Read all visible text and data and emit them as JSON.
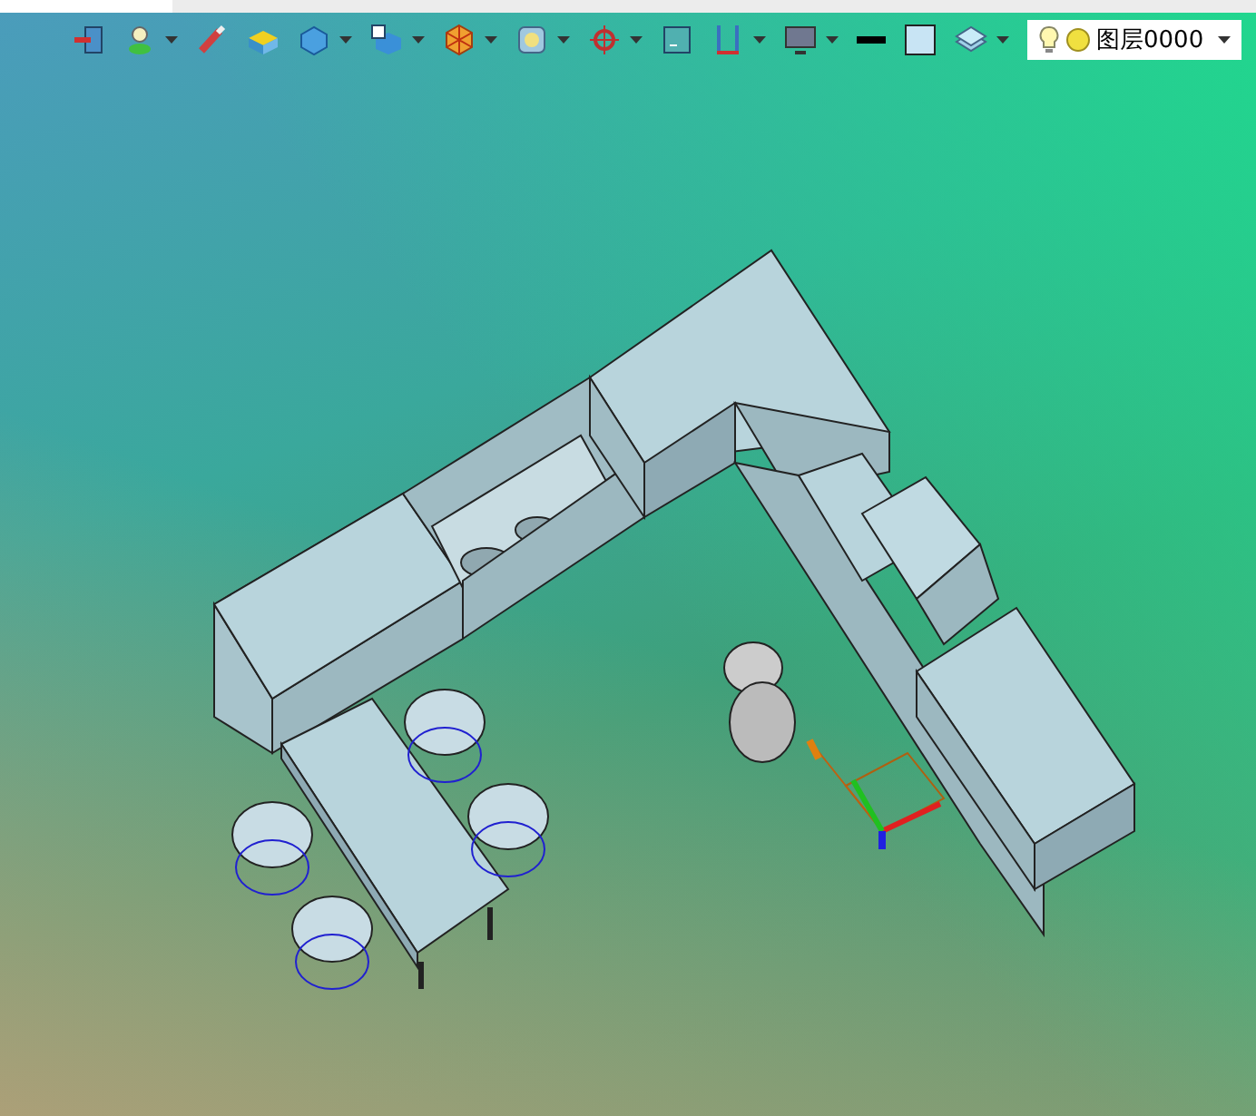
{
  "toolbar": {
    "buttons": [
      {
        "kind": "exit",
        "dropdown": false
      },
      {
        "kind": "light",
        "dropdown": true
      },
      {
        "kind": "brush",
        "dropdown": false
      },
      {
        "kind": "box",
        "dropdown": false
      },
      {
        "kind": "cube",
        "dropdown": true
      },
      {
        "kind": "viewcube",
        "dropdown": true
      },
      {
        "kind": "ball",
        "dropdown": true
      },
      {
        "kind": "zoom",
        "dropdown": true
      },
      {
        "kind": "orbit",
        "dropdown": true
      },
      {
        "kind": "frame",
        "dropdown": false
      },
      {
        "kind": "section",
        "dropdown": true
      },
      {
        "kind": "monitor",
        "dropdown": true
      },
      {
        "kind": "linecolor",
        "dropdown": false
      },
      {
        "kind": "fillcolor",
        "dropdown": false
      },
      {
        "kind": "layers",
        "dropdown": true
      }
    ]
  },
  "layer_selector": {
    "value": "图层0000"
  }
}
